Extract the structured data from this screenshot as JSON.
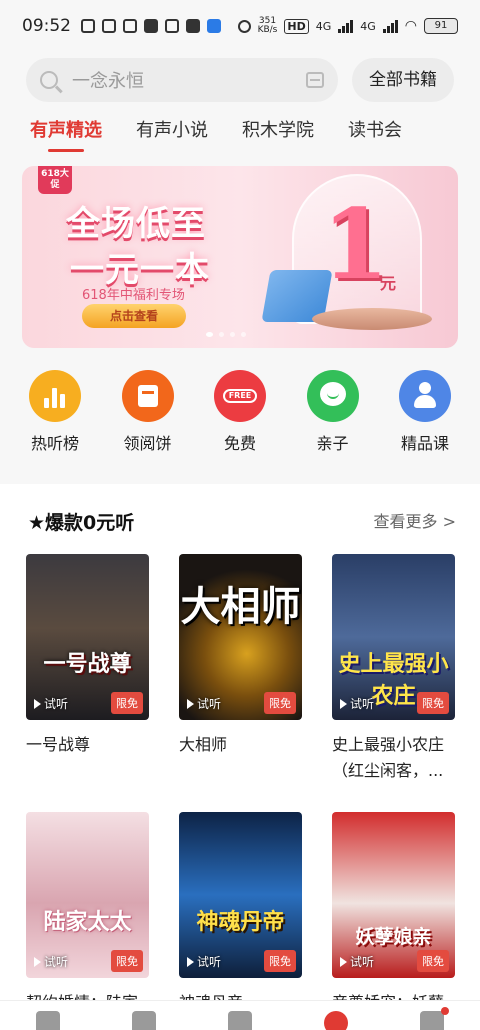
{
  "status_bar": {
    "time": "09:52",
    "net_speed": "351",
    "net_speed_unit": "KB/s",
    "hd": "HD",
    "signal1": "4G",
    "signal2": "4G",
    "battery": "91"
  },
  "search": {
    "placeholder": "一念永恒",
    "all_books_label": "全部书籍"
  },
  "tabs": [
    {
      "label": "有声精选",
      "active": true
    },
    {
      "label": "有声小说",
      "active": false
    },
    {
      "label": "积木学院",
      "active": false
    },
    {
      "label": "读书会",
      "active": false
    }
  ],
  "banner": {
    "badge": "618大促",
    "title_line1": "全场低至",
    "title_line2": "一元一本",
    "subtitle": "618年中福利专场",
    "button": "点击查看",
    "big_number": "1",
    "unit": "元"
  },
  "categories": [
    {
      "label": "热听榜",
      "icon": "bar-chart-icon",
      "color": "#f7ae20"
    },
    {
      "label": "领阅饼",
      "icon": "envelope-icon",
      "color": "#f2671b"
    },
    {
      "label": "免费",
      "icon": "free-icon",
      "icon_text": "FREE",
      "color": "#ec3c41"
    },
    {
      "label": "亲子",
      "icon": "chat-bubble-icon",
      "color": "#33bf59"
    },
    {
      "label": "精品课",
      "icon": "person-icon",
      "color": "#4f86e6"
    }
  ],
  "section": {
    "title": "★爆款0元听",
    "more": "查看更多 >"
  },
  "books": [
    {
      "name": "一号战尊",
      "cover_title": "一号战尊",
      "trial": "试听",
      "limit": "限免"
    },
    {
      "name": "大相师",
      "cover_title": "大相师",
      "trial": "试听",
      "limit": "限免"
    },
    {
      "name": "史上最强小农庄（红尘闲客，...",
      "cover_title": "史上最强小农庄",
      "trial": "试听",
      "limit": "限免"
    },
    {
      "name": "契约婚情：陆家",
      "cover_title": "陆家太太",
      "trial": "试听",
      "limit": "限免"
    },
    {
      "name": "神魂丹帝",
      "cover_title": "神魂丹帝",
      "trial": "试听",
      "limit": "限免"
    },
    {
      "name": "帝尊娇宠：妖孽",
      "cover_title": "妖孽娘亲",
      "trial": "试听",
      "limit": "限免"
    }
  ],
  "colors": {
    "accent": "#e03a33",
    "limit_badge": "#e34b3f"
  }
}
